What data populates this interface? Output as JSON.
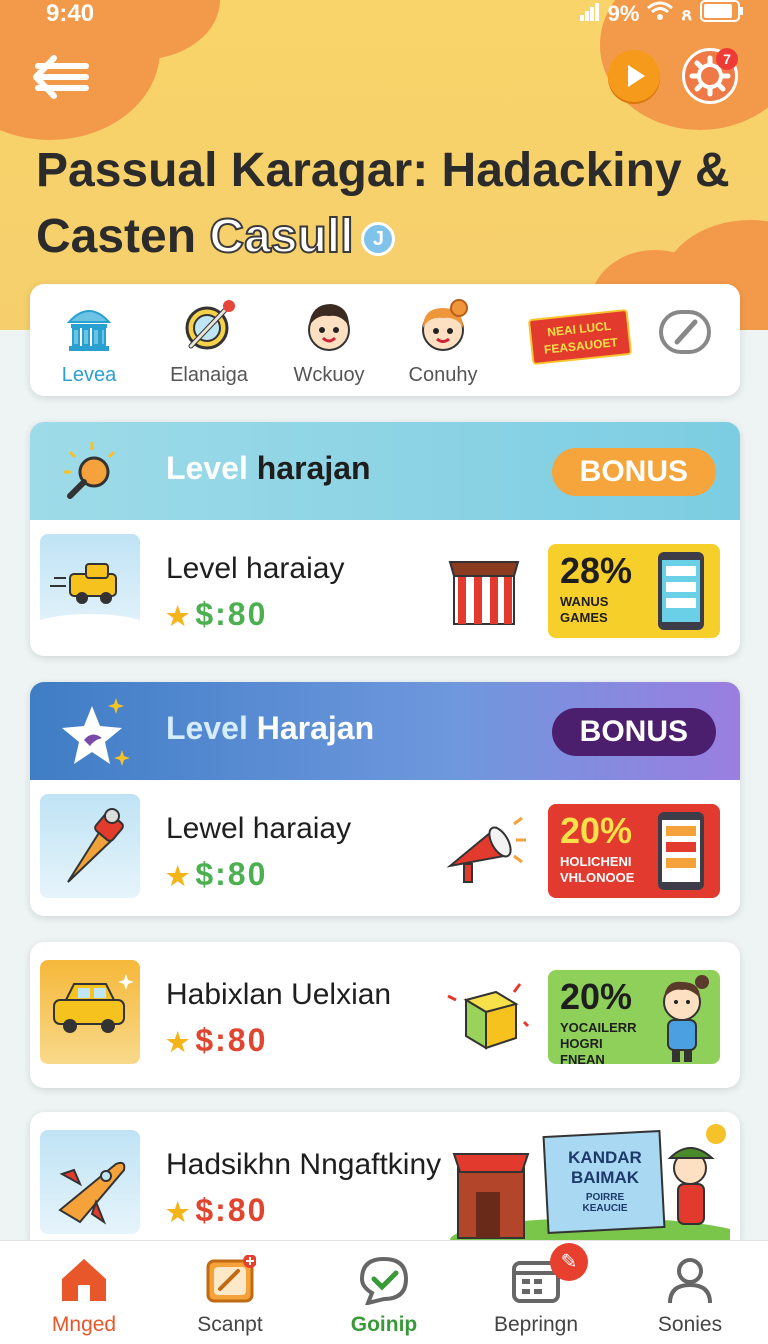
{
  "status": {
    "time": "9:40",
    "signal": "9%",
    "icons": [
      "signal-icon",
      "wifi-icon",
      "battery-icon"
    ]
  },
  "header": {
    "title_line1": "Passual Karagar: Hadackiny &",
    "title_line2_a": "Casten",
    "title_line2_b": "Casull",
    "badge_glyph": "J",
    "notification_count": "7"
  },
  "categories": [
    {
      "label": "Levea",
      "icon": "temple-icon",
      "active": true
    },
    {
      "label": "Elanaiga",
      "icon": "magnifier-wand-icon"
    },
    {
      "label": "Wckuoy",
      "icon": "boy-face-icon"
    },
    {
      "label": "Conuhy",
      "icon": "girl-face-icon"
    },
    {
      "label": "",
      "banner_text": "NEAI LUCL\nFEASAUOET",
      "icon": "ribbon-banner-icon"
    },
    {
      "label": "",
      "icon": "gauge-icon"
    }
  ],
  "cards": [
    {
      "header": {
        "title_a": "Level",
        "title_b": "harajan",
        "bonus": "BONUS",
        "bg": "#8fd3e4",
        "bonus_bg": "#f5a53c",
        "bonus_fg": "#ffffff"
      },
      "row": {
        "title": "Level haraiay",
        "price": "$:80",
        "price_color": "#4caf50",
        "promo_pct": "28%",
        "promo_sub": "WANUS GAMES",
        "promo_bg": "#f7cf2b",
        "promo_fg": "#1e1e1e"
      }
    },
    {
      "header": {
        "title_a": "Level",
        "title_b": "Harajan",
        "bonus": "BONUS",
        "bg": "#5f95d8",
        "bonus_bg": "#4b1f6e",
        "bonus_fg": "#ffffff"
      },
      "row": {
        "title": "Lewel haraiay",
        "price": "$:80",
        "price_color": "#4caf50",
        "promo_pct": "20%",
        "promo_sub": "HOLICHENI VHLONOOE",
        "promo_bg": "#e23a2e",
        "promo_fg": "#ffffff"
      }
    },
    {
      "row": {
        "title": "Habixlan Uelxian",
        "price": "$:80",
        "price_color": "#e0452f",
        "promo_pct": "20%",
        "promo_sub": "YOCAILERR HOGRI FNEAN",
        "promo_bg": "#8fd05a",
        "promo_fg": "#1e1e1e"
      }
    },
    {
      "row": {
        "title": "Hadsikhn Nngaftkiny",
        "price": "$:80",
        "price_color": "#e0452f",
        "promo_banner": "KANDAR BAIMAK",
        "promo_banner_sub": "POIRRE KEAUCIE"
      }
    }
  ],
  "bottom_nav": [
    {
      "label": "Mnged",
      "icon": "home-icon",
      "active": true,
      "color": "#e8572a"
    },
    {
      "label": "Scanpt",
      "icon": "ticket-plus-icon",
      "color": "#444444"
    },
    {
      "label": "Goinip",
      "icon": "chat-check-icon",
      "color": "#3a9a3a"
    },
    {
      "label": "Bepringn",
      "icon": "calendar-icon",
      "color": "#444444",
      "badge": "✎"
    },
    {
      "label": "Sonies",
      "icon": "person-icon",
      "color": "#444444"
    }
  ]
}
